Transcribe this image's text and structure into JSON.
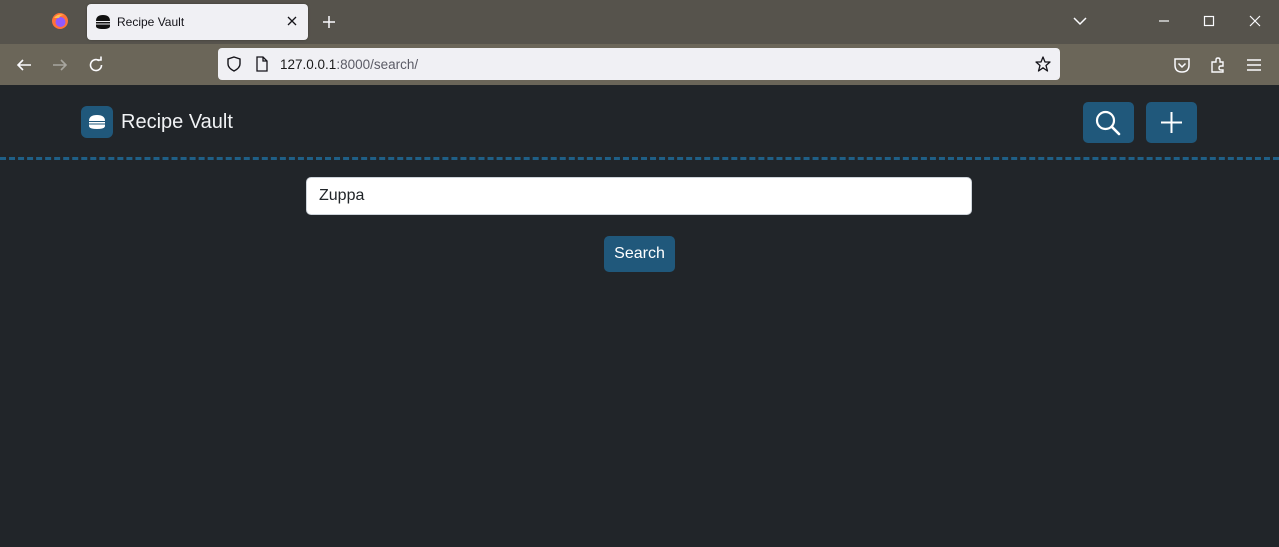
{
  "browser": {
    "tab_title": "Recipe Vault",
    "url_host": "127.0.0.1",
    "url_rest": ":8000/search/"
  },
  "app": {
    "brand_name": "Recipe Vault",
    "search_value": "Zuppa",
    "search_button_label": "Search",
    "accent_color": "#20587b",
    "background_color": "#212529"
  },
  "icons": {
    "logo": "burger-icon",
    "header_search": "search-icon",
    "header_add": "plus-icon"
  }
}
